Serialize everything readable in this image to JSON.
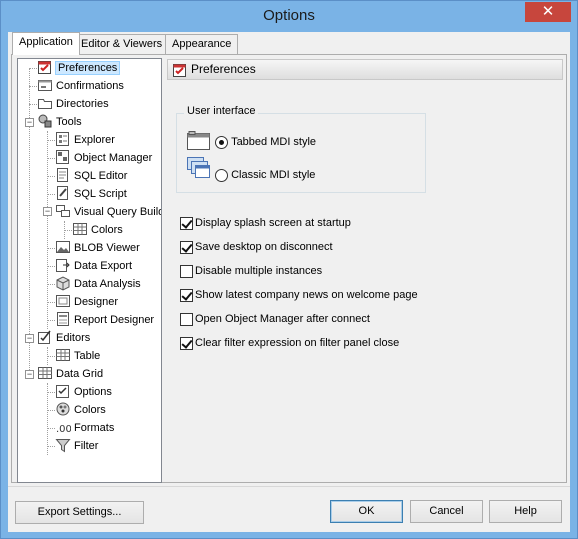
{
  "window": {
    "title": "Options",
    "close_glyph": "✕"
  },
  "tabs": [
    {
      "label": "Application",
      "active": true
    },
    {
      "label": "Editor & Viewers",
      "active": false
    },
    {
      "label": "Appearance",
      "active": false
    }
  ],
  "tree": {
    "items": [
      {
        "label": "Preferences",
        "icon": "preferences-icon",
        "selected": true
      },
      {
        "label": "Confirmations",
        "icon": "confirm-icon"
      },
      {
        "label": "Directories",
        "icon": "folder-icon"
      },
      {
        "label": "Tools",
        "icon": "tools-icon"
      },
      {
        "label": "Explorer",
        "icon": "explorer-icon"
      },
      {
        "label": "Object Manager",
        "icon": "object-manager-icon"
      },
      {
        "label": "SQL Editor",
        "icon": "sql-editor-icon"
      },
      {
        "label": "SQL Script",
        "icon": "sql-script-icon"
      },
      {
        "label": "Visual Query Build",
        "icon": "query-builder-icon"
      },
      {
        "label": "Colors",
        "icon": "colors-icon"
      },
      {
        "label": "BLOB Viewer",
        "icon": "blob-viewer-icon"
      },
      {
        "label": "Data Export",
        "icon": "data-export-icon"
      },
      {
        "label": "Data Analysis",
        "icon": "data-analysis-icon"
      },
      {
        "label": "Designer",
        "icon": "designer-icon"
      },
      {
        "label": "Report Designer",
        "icon": "report-designer-icon"
      },
      {
        "label": "Editors",
        "icon": "editors-icon"
      },
      {
        "label": "Table",
        "icon": "table-icon"
      },
      {
        "label": "Data Grid",
        "icon": "data-grid-icon"
      },
      {
        "label": "Options",
        "icon": "options-icon"
      },
      {
        "label": "Colors",
        "icon": "colors-icon"
      },
      {
        "label": "Formats",
        "icon": "formats-icon"
      },
      {
        "label": "Filter",
        "icon": "filter-icon"
      }
    ]
  },
  "panel": {
    "header": "Preferences",
    "group_title": "User interface",
    "radios": [
      {
        "label": "Tabbed MDI style",
        "checked": true
      },
      {
        "label": "Classic MDI style",
        "checked": false
      }
    ],
    "checkboxes": [
      {
        "label": "Display splash screen at startup",
        "checked": true
      },
      {
        "label": "Save desktop on disconnect",
        "checked": true
      },
      {
        "label": "Disable multiple instances",
        "checked": false
      },
      {
        "label": "Show latest company news on welcome page",
        "checked": true
      },
      {
        "label": "Open Object Manager after connect",
        "checked": false
      },
      {
        "label": "Clear filter expression on filter panel close",
        "checked": true
      }
    ]
  },
  "buttons": {
    "export": "Export Settings...",
    "ok": "OK",
    "cancel": "Cancel",
    "help": "Help"
  }
}
